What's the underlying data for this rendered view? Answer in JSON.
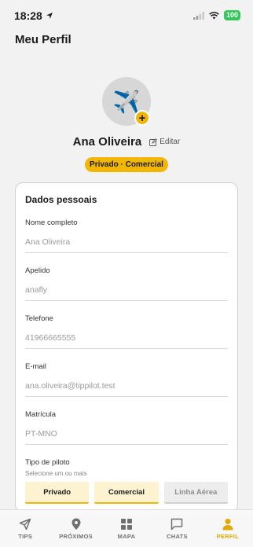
{
  "status": {
    "time": "18:28",
    "battery": "100"
  },
  "page": {
    "title": "Meu Perfil"
  },
  "profile": {
    "avatar_icon": "airplane-emoji",
    "avatar_glyph": "✈️",
    "add_glyph": "+",
    "name": "Ana Oliveira",
    "edit_label": "Editar",
    "badge": "Privado · Comercial"
  },
  "card": {
    "title": "Dados pessoais",
    "fields": [
      {
        "label": "Nome completo",
        "value": "Ana Oliveira"
      },
      {
        "label": "Apelido",
        "value": "anafly"
      },
      {
        "label": "Telefone",
        "value": "41966665555"
      },
      {
        "label": "E-mail",
        "value": "ana.oliveira@tippilot.test"
      },
      {
        "label": "Matrícula",
        "value": "PT-MNO"
      }
    ],
    "pilot_type": {
      "label": "Tipo de piloto",
      "hint": "Selecione um ou mais",
      "options": [
        {
          "label": "Privado",
          "selected": true
        },
        {
          "label": "Comercial",
          "selected": true
        },
        {
          "label": "Linha Aérea",
          "selected": false
        }
      ]
    }
  },
  "tabs": [
    {
      "label": "TIPS",
      "icon": "send-icon",
      "active": false
    },
    {
      "label": "PRÓXIMOS",
      "icon": "location-pin-icon",
      "active": false
    },
    {
      "label": "MAPA",
      "icon": "grid-icon",
      "active": false
    },
    {
      "label": "CHATS",
      "icon": "chat-icon",
      "active": false
    },
    {
      "label": "PERFIL",
      "icon": "person-icon",
      "active": true
    }
  ],
  "colors": {
    "accent": "#f2b705",
    "active_tab": "#e0a800",
    "background": "#f2f2f2",
    "card": "#ffffff"
  }
}
